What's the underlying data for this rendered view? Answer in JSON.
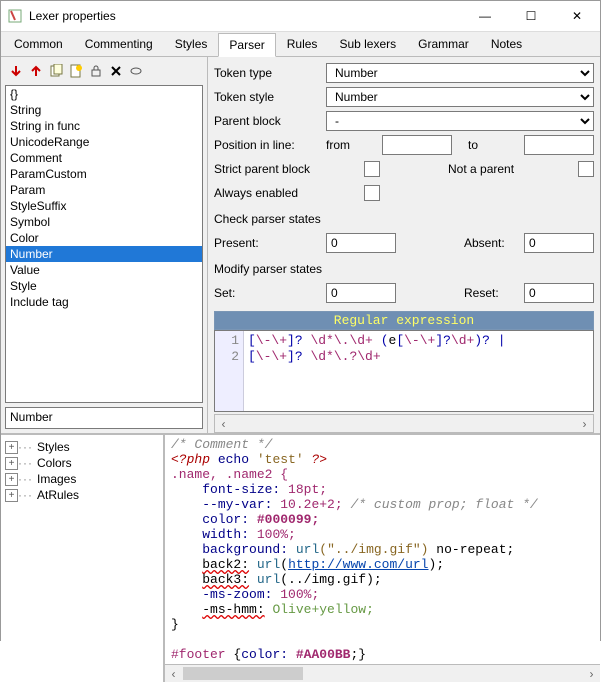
{
  "title": "Lexer properties",
  "winbtns": {
    "min": "—",
    "max": "☐",
    "close": "✕"
  },
  "tabs": [
    "Common",
    "Commenting",
    "Styles",
    "Parser",
    "Rules",
    "Sub lexers",
    "Grammar",
    "Notes"
  ],
  "active_tab": 3,
  "toolbar_icons": [
    "arrow-down",
    "arrow-up",
    "copy",
    "new",
    "lock",
    "delete",
    "edit"
  ],
  "rules": [
    "{}",
    "String",
    "String in func",
    "UnicodeRange",
    "Comment",
    "ParamCustom",
    "Param",
    "StyleSuffix",
    "Symbol",
    "Color",
    "Number",
    "Value",
    "Style",
    "Include tag"
  ],
  "selected_rule_index": 10,
  "current_rule": "Number",
  "form": {
    "token_type_label": "Token type",
    "token_type_value": "Number",
    "token_style_label": "Token style",
    "token_style_value": "Number",
    "parent_block_label": "Parent block",
    "parent_block_value": "-",
    "position_label": "Position in line:",
    "from_label": "from",
    "from_value": "",
    "to_label": "to",
    "to_value": "",
    "strict_parent_label": "Strict parent block",
    "not_a_parent_label": "Not a parent",
    "always_enabled_label": "Always enabled",
    "check_states_label": "Check parser states",
    "present_label": "Present:",
    "present_value": "0",
    "absent_label": "Absent:",
    "absent_value": "0",
    "modify_states_label": "Modify parser states",
    "set_label": "Set:",
    "set_value": "0",
    "reset_label": "Reset:",
    "reset_value": "0"
  },
  "regex_header": "Regular expression",
  "regex_lines": [
    "[\\-\\+]? \\d*\\.\\d+ (e[\\-\\+]?\\d+)? |",
    "[\\-\\+]? \\d*\\.?\\d+"
  ],
  "tree": [
    "Styles",
    "Colors",
    "Images",
    "AtRules"
  ],
  "preview": {
    "l1_comment": "/* Comment */",
    "l2_open": "<?php",
    "l2_echo": "echo",
    "l2_str": "'test'",
    "l2_close": "?>",
    "l3_sel": ".name, .name2 {",
    "l4_prop": "font-size:",
    "l4_val": "18pt;",
    "l5_prop": "--my-var:",
    "l5_val": "10.2e+2;",
    "l5_comment": "/* custom prop; float */",
    "l6_prop": "color:",
    "l6_val": "#000099;",
    "l7_prop": "width:",
    "l7_val": "100%;",
    "l8_prop": "background:",
    "l8_func": "url",
    "l8_arg": "(\"../img.gif\")",
    "l8_rest": " no-repeat;",
    "l9_prop": "back2:",
    "l9_func": "url",
    "l9_arg": "(http://www.com/url)",
    "l9_end": ";",
    "l10_prop": "back3:",
    "l10_func": "url",
    "l10_arg": "(../img.gif)",
    "l10_end": ";",
    "l11_prop": "-ms-zoom:",
    "l11_val": "100%;",
    "l12_prop": "-ms-hmm:",
    "l12_val": "Olive+yellow;",
    "l13": "}",
    "l15_sel": "#footer ",
    "l15_open": "{",
    "l15_prop": "color:",
    "l15_val": "#AA00BB",
    "l15_end": ";}"
  }
}
